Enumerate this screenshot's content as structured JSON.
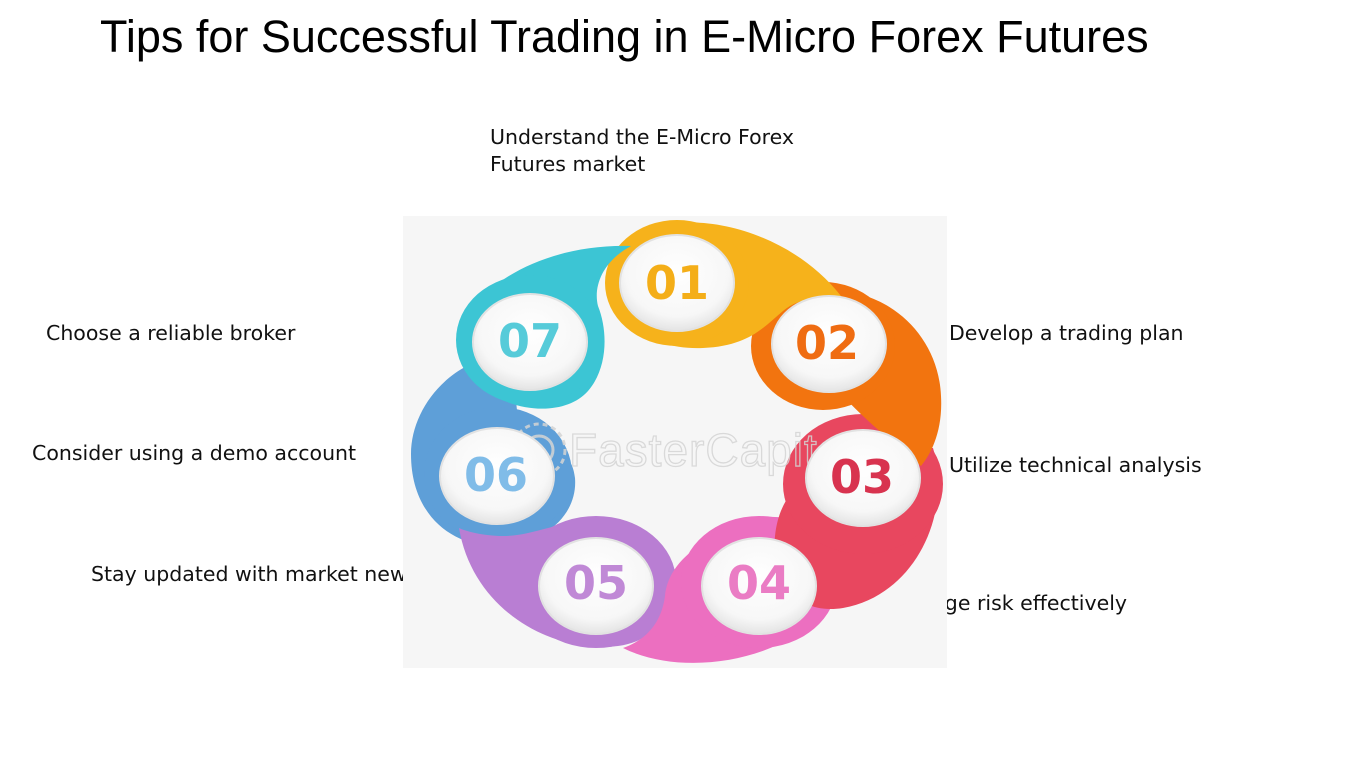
{
  "title": "Tips for Successful Trading in E-Micro Forex Futures",
  "watermark": "FasterCapital",
  "steps": [
    {
      "number": "01",
      "label_lines": [
        "Understand the E-Micro Forex",
        "Futures market"
      ],
      "color": "#f6b21b",
      "num_color": "#f4ae18"
    },
    {
      "number": "02",
      "label_lines": [
        "Develop a trading plan"
      ],
      "color": "#f2740f",
      "num_color": "#ef6c12"
    },
    {
      "number": "03",
      "label_lines": [
        "Utilize technical analysis"
      ],
      "color": "#e8475f",
      "num_color": "#d8334f"
    },
    {
      "number": "04",
      "label_lines": [
        "Manage risk effectively"
      ],
      "color": "#ec6fc0",
      "num_color": "#ea7cc4"
    },
    {
      "number": "05",
      "label_lines": [
        "Stay updated with market news"
      ],
      "color": "#b97ed3",
      "num_color": "#c089d6"
    },
    {
      "number": "06",
      "label_lines": [
        "Consider using a demo account"
      ],
      "color": "#5e9fd8",
      "num_color": "#80bce8"
    },
    {
      "number": "07",
      "label_lines": [
        "Choose a reliable broker"
      ],
      "color": "#3cc5d4",
      "num_color": "#56cbd9"
    }
  ]
}
